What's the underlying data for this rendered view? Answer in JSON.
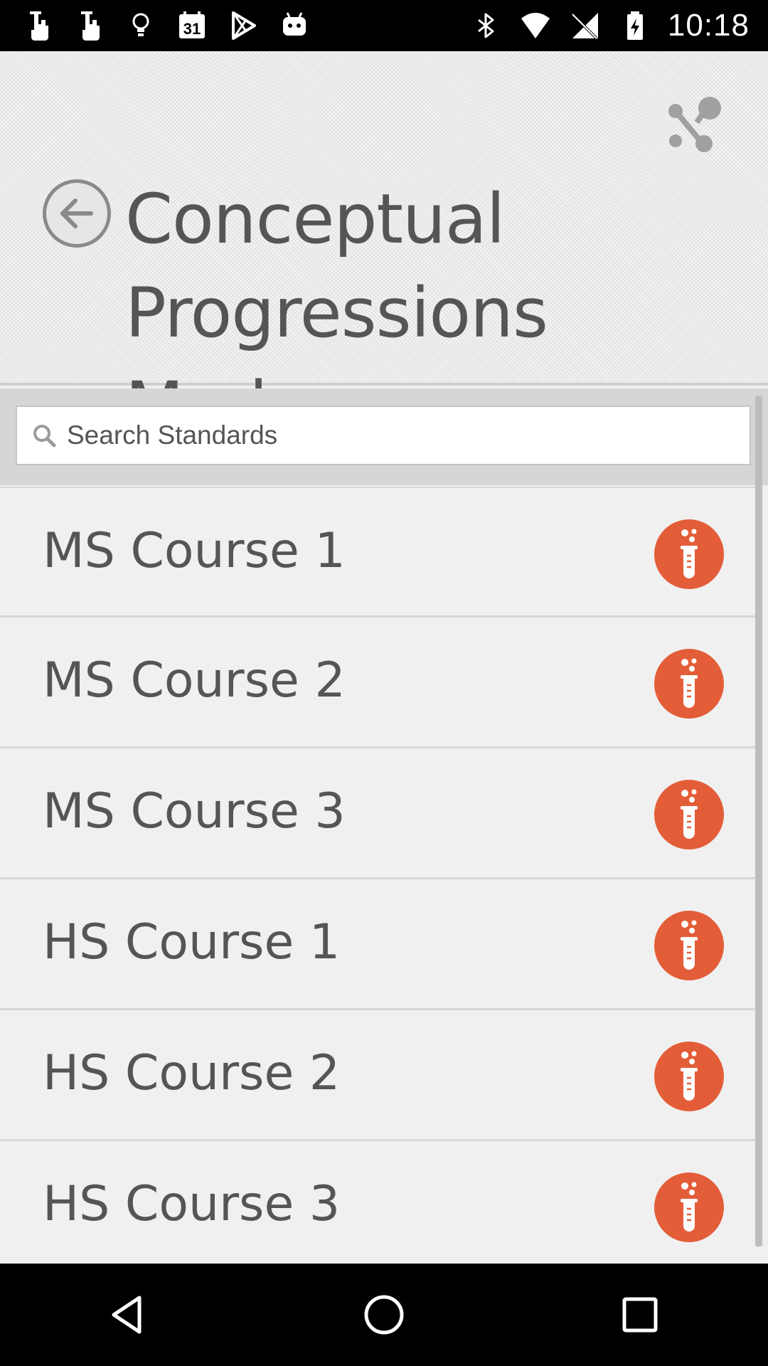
{
  "status_bar": {
    "time": "10:18",
    "calendar_day": "31",
    "left_icons": [
      "touch-icon",
      "touch-icon",
      "lightbulb-icon",
      "calendar-icon",
      "play-store-icon",
      "android-icon"
    ],
    "right_icons": [
      "bluetooth-icon",
      "wifi-icon",
      "no-signal-icon",
      "battery-charging-icon"
    ]
  },
  "header": {
    "title": "Conceptual Progressions Mode",
    "back_icon": "arrow-left-icon",
    "share_icon": "share-icon"
  },
  "search": {
    "placeholder": "Search Standards",
    "value": ""
  },
  "courses": [
    {
      "label": "MS Course 1",
      "icon": "test-tube-icon"
    },
    {
      "label": "MS Course 2",
      "icon": "test-tube-icon"
    },
    {
      "label": "MS Course 3",
      "icon": "test-tube-icon"
    },
    {
      "label": "HS Course 1",
      "icon": "test-tube-icon"
    },
    {
      "label": "HS Course 2",
      "icon": "test-tube-icon"
    },
    {
      "label": "HS Course 3",
      "icon": "test-tube-icon"
    }
  ],
  "nav_bar": {
    "icons": [
      "back-triangle-icon",
      "home-circle-icon",
      "recents-square-icon"
    ]
  },
  "colors": {
    "accent": "#e35d38",
    "header_bg": "#e9e9e9",
    "list_bg": "#f0f0f0",
    "text": "#555555"
  }
}
